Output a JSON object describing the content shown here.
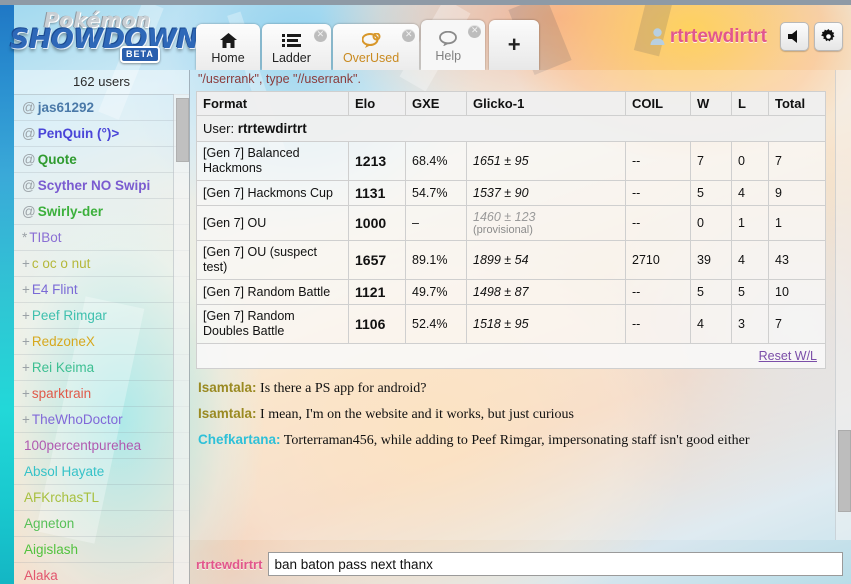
{
  "brand": {
    "line1": "Pokémon",
    "line2": "SHOWDOWN",
    "badge": "BETA"
  },
  "header": {
    "tabs": [
      {
        "label": "Home",
        "icon": "home-icon",
        "closable": false,
        "current": false
      },
      {
        "label": "Ladder",
        "icon": "list-icon",
        "closable": true,
        "current": false
      },
      {
        "label": "OverUsed",
        "icon": "chat-bubble-icon",
        "closable": true,
        "current": false
      },
      {
        "label": "Help",
        "icon": "chat-bubble-outline-icon",
        "closable": true,
        "current": true
      }
    ],
    "add_tab_label": "+",
    "username": "rtrtewdirtrt",
    "username_color": "#e2568c",
    "volume_icon": "speaker-icon",
    "settings_icon": "gear-icon"
  },
  "userlist": {
    "count_label": "162 users",
    "users": [
      {
        "rank": "@",
        "name": "jas61292",
        "color": "#4a79a8",
        "bold": true
      },
      {
        "rank": "@",
        "name": "PenQuin (°)>",
        "color": "#4a45d8",
        "bold": true
      },
      {
        "rank": "@",
        "name": "Quote",
        "color": "#2f9b2f",
        "bold": true
      },
      {
        "rank": "@",
        "name": "Scyther NO Swipi",
        "color": "#7a5bd0",
        "bold": true
      },
      {
        "rank": "@",
        "name": "Swirly-der",
        "color": "#3cb03c",
        "bold": true
      },
      {
        "rank": "*",
        "name": "TIBot",
        "color": "#8a6fd4",
        "bold": false
      },
      {
        "rank": "+",
        "name": "c oc o nut",
        "color": "#b5b83a",
        "bold": false
      },
      {
        "rank": "+",
        "name": "E4 Flint",
        "color": "#7a6ad6",
        "bold": false
      },
      {
        "rank": "+",
        "name": "Peef Rimgar",
        "color": "#3fc0ae",
        "bold": false
      },
      {
        "rank": "+",
        "name": "RedzoneX",
        "color": "#d6a81e",
        "bold": false
      },
      {
        "rank": "+",
        "name": "Rei Keima",
        "color": "#3dbf92",
        "bold": false
      },
      {
        "rank": "+",
        "name": "sparktrain",
        "color": "#e05a4a",
        "bold": false
      },
      {
        "rank": "+",
        "name": "TheWhoDoctor",
        "color": "#8068d8",
        "bold": false
      },
      {
        "rank": "",
        "name": "100percentpurehea",
        "color": "#b05ab0",
        "bold": false
      },
      {
        "rank": "",
        "name": "Absol Hayate",
        "color": "#36c2c8",
        "bold": false
      },
      {
        "rank": "",
        "name": "AFKrchasTL",
        "color": "#a8c040",
        "bold": false
      },
      {
        "rank": "",
        "name": "Agneton",
        "color": "#58c058",
        "bold": false
      },
      {
        "rank": "",
        "name": "Aigislash",
        "color": "#52c23e",
        "bold": false
      },
      {
        "rank": "",
        "name": "Alaka",
        "color": "#e2566e",
        "bold": false
      }
    ]
  },
  "main": {
    "notice": "\"/userrank\", type \"//userrank\".",
    "rank_table": {
      "user_label": "User:",
      "user_name": "rtrtewdirtrt",
      "columns": [
        "Format",
        "Elo",
        "GXE",
        "Glicko-1",
        "COIL",
        "W",
        "L",
        "Total"
      ],
      "rows": [
        {
          "format": "[Gen 7] Balanced Hackmons",
          "elo": "1213",
          "gxe": "68.4%",
          "glicko": "1651 ± 95",
          "provisional": "",
          "coil": "--",
          "w": "7",
          "l": "0",
          "total": "7"
        },
        {
          "format": "[Gen 7] Hackmons Cup",
          "elo": "1131",
          "gxe": "54.7%",
          "glicko": "1537 ± 90",
          "provisional": "",
          "coil": "--",
          "w": "5",
          "l": "4",
          "total": "9"
        },
        {
          "format": "[Gen 7] OU",
          "elo": "1000",
          "gxe": "–",
          "glicko": "1460 ± 123",
          "provisional": "(provisional)",
          "coil": "--",
          "w": "0",
          "l": "1",
          "total": "1"
        },
        {
          "format": "[Gen 7] OU (suspect test)",
          "elo": "1657",
          "gxe": "89.1%",
          "glicko": "1899 ± 54",
          "provisional": "",
          "coil": "2710",
          "w": "39",
          "l": "4",
          "total": "43"
        },
        {
          "format": "[Gen 7] Random Battle",
          "elo": "1121",
          "gxe": "49.7%",
          "glicko": "1498 ± 87",
          "provisional": "",
          "coil": "--",
          "w": "5",
          "l": "5",
          "total": "10"
        },
        {
          "format": "[Gen 7] Random Doubles Battle",
          "elo": "1106",
          "gxe": "52.4%",
          "glicko": "1518 ± 95",
          "provisional": "",
          "coil": "--",
          "w": "4",
          "l": "3",
          "total": "7"
        }
      ],
      "reset_link": "Reset W/L"
    },
    "messages": [
      {
        "who": "Isamtala:",
        "color": "#9a8a22",
        "text": "Is there a PS app for android?"
      },
      {
        "who": "Isamtala:",
        "color": "#9a8a22",
        "text": "I mean, I'm on the website and it works, but just curious"
      },
      {
        "who": "Chefkartana:",
        "color": "#2ec0d8",
        "text": "Torterraman456, while adding to Peef Rimgar, impersonating staff isn't good either"
      }
    ],
    "chatbar": {
      "username": "rtrtewdirtrt",
      "value": "ban baton pass next thanx",
      "placeholder": ""
    }
  }
}
